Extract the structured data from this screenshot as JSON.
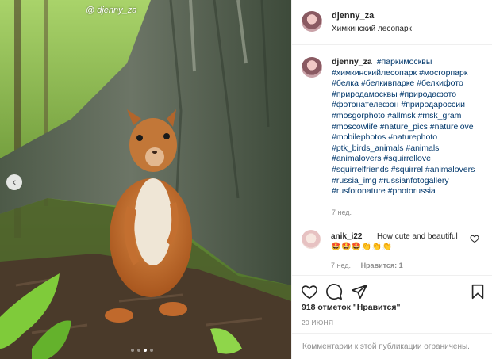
{
  "post": {
    "watermark": "@ djenny_za",
    "carousel": {
      "total": 4,
      "active": 3
    }
  },
  "header": {
    "username": "djenny_za",
    "location": "Химкинский лесопарк"
  },
  "caption": {
    "username": "djenny_za",
    "tags": [
      "#паркимосквы",
      "#химкинскийлесопарк",
      "#мосгорпарк",
      "#белка",
      "#белкивпарке",
      "#белкифото",
      "#природамосквы",
      "#природафото",
      "#фотонателефон",
      "#природароссии",
      "#mosgorphoto",
      "#allmsk",
      "#msk_gram",
      "#moscowlife",
      "#nature_pics",
      "#naturelove",
      "#mobilephotos",
      "#naturephoto",
      "#ptk_birds_animals",
      "#animals",
      "#animalovers",
      "#squirrellove",
      "#squirrelfriends",
      "#squirrel",
      "#animalovers",
      "#russia_img",
      "#russianfotogallery",
      "#rusfotonature",
      "#photorussia"
    ],
    "time": "7 нед."
  },
  "comment": {
    "username": "anik_i22",
    "text": "How cute and beautiful",
    "emoji": "🤩🤩🤩👏👏👏",
    "time": "7 нед.",
    "likes": "Нравится: 1"
  },
  "actions": {
    "likes_count": "918 отметок \"Нравится\"",
    "date": "20 ИЮНЯ"
  },
  "comments_closed": "Комментарии к этой публикации ограничены.",
  "icons": {
    "prev": "chevron-left-icon",
    "like": "heart-icon",
    "comment": "comment-icon",
    "share": "send-icon",
    "save": "bookmark-icon"
  }
}
